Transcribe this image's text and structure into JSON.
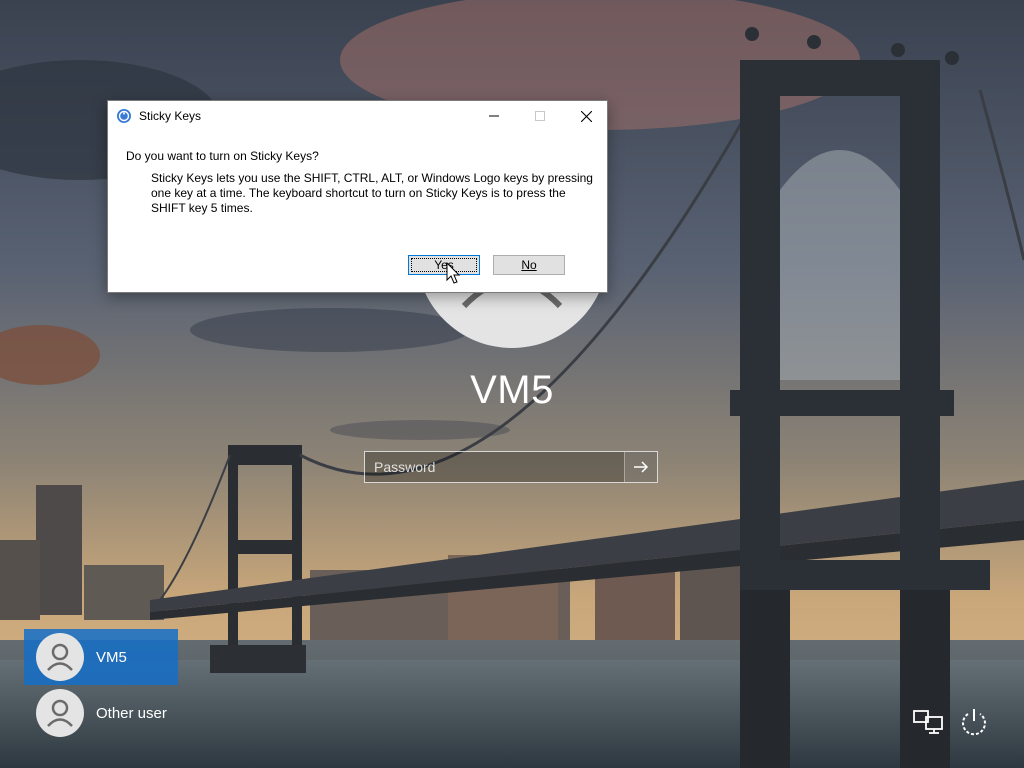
{
  "lockscreen": {
    "username": "VM5",
    "password_placeholder": "Password",
    "submit_icon": "arrow-right-icon"
  },
  "users": [
    {
      "name": "VM5",
      "selected": true
    },
    {
      "name": "Other user",
      "selected": false
    }
  ],
  "corner_icons": [
    "network-icon",
    "power-icon"
  ],
  "dialog": {
    "title": "Sticky Keys",
    "question": "Do you want to turn on Sticky Keys?",
    "description": "Sticky Keys lets you use the SHIFT, CTRL, ALT, or Windows Logo keys by pressing one key at a time. The keyboard shortcut to turn on Sticky Keys is to press the SHIFT key 5 times.",
    "yes_label": "Yes",
    "no_label": "No",
    "controls": [
      "minimize-icon",
      "maximize-icon",
      "close-icon"
    ]
  },
  "colors": {
    "selected_user": "#1e6ec8",
    "dialog_bg": "#ffffff",
    "button_bg": "#e1e1e1",
    "focus_border": "#0078d7"
  }
}
